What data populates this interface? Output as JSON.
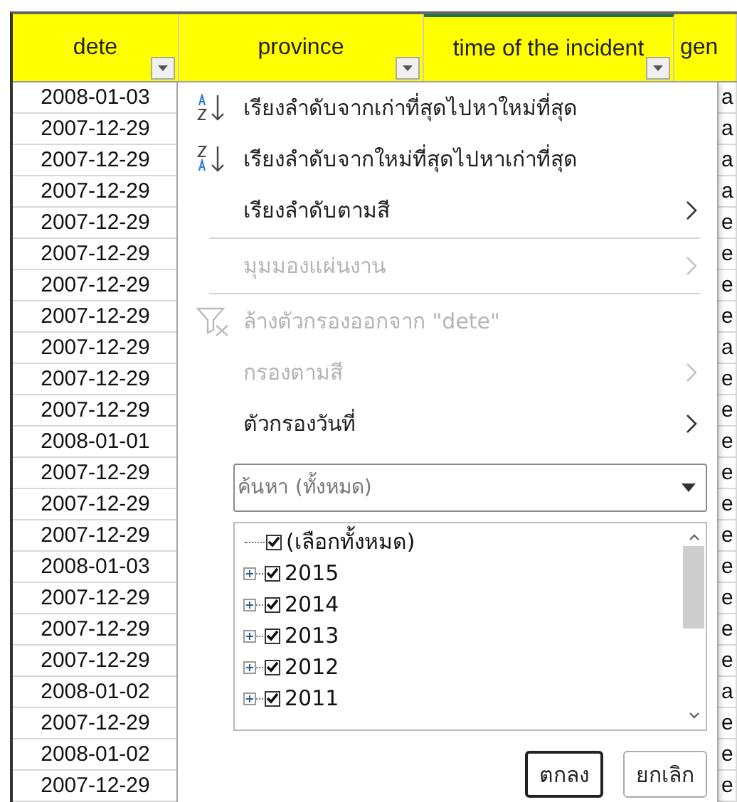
{
  "sheet": {
    "headers": [
      {
        "label": "dete",
        "filter_button": true,
        "selected": false
      },
      {
        "label": "province",
        "filter_button": true,
        "selected": false
      },
      {
        "label": "time of the incident",
        "filter_button": true,
        "selected": true
      },
      {
        "label": "gen",
        "filter_button": false,
        "selected": false
      }
    ],
    "rows": [
      {
        "dete": "2008-01-03",
        "column_4": "a"
      },
      {
        "dete": "2007-12-29",
        "column_4": "a"
      },
      {
        "dete": "2007-12-29",
        "column_4": "a"
      },
      {
        "dete": "2007-12-29",
        "column_4": "a"
      },
      {
        "dete": "2007-12-29",
        "column_4": "e"
      },
      {
        "dete": "2007-12-29",
        "column_4": "e"
      },
      {
        "dete": "2007-12-29",
        "column_4": "e"
      },
      {
        "dete": "2007-12-29",
        "column_4": "e"
      },
      {
        "dete": "2007-12-29",
        "column_4": "a"
      },
      {
        "dete": "2007-12-29",
        "column_4": "e"
      },
      {
        "dete": "2007-12-29",
        "column_4": "e"
      },
      {
        "dete": "2008-01-01",
        "column_4": "e"
      },
      {
        "dete": "2007-12-29",
        "column_4": "e"
      },
      {
        "dete": "2007-12-29",
        "column_4": "e"
      },
      {
        "dete": "2007-12-29",
        "column_4": "e"
      },
      {
        "dete": "2008-01-03",
        "column_4": "e"
      },
      {
        "dete": "2007-12-29",
        "column_4": "e"
      },
      {
        "dete": "2007-12-29",
        "column_4": "e"
      },
      {
        "dete": "2007-12-29",
        "column_4": "e"
      },
      {
        "dete": "2008-01-02",
        "column_4": "a"
      },
      {
        "dete": "2007-12-29",
        "column_4": "e"
      },
      {
        "dete": "2008-01-02",
        "column_4": "e"
      },
      {
        "dete": "2007-12-29",
        "column_4": "e"
      }
    ]
  },
  "filter_menu": {
    "items": [
      {
        "kind": "sort_ascending",
        "label": "เรียงลำดับจากเก่าที่สุดไปหาใหม่ที่สุด",
        "disabled": false,
        "submenu": false
      },
      {
        "kind": "sort_descending",
        "label": "เรียงลำดับจากใหม่ที่สุดไปหาเก่าที่สุด",
        "disabled": false,
        "submenu": false
      },
      {
        "kind": "plain",
        "label": "เรียงลำดับตามสี",
        "disabled": false,
        "submenu": true
      },
      {
        "kind": "separator"
      },
      {
        "kind": "plain",
        "label": "มุมมองแผ่นงาน",
        "disabled": true,
        "submenu": true
      },
      {
        "kind": "separator"
      },
      {
        "kind": "clear_filter",
        "label": "ล้างตัวกรองออกจาก \"dete\"",
        "disabled": true,
        "submenu": false
      },
      {
        "kind": "plain",
        "label": "กรองตามสี",
        "disabled": true,
        "submenu": true
      },
      {
        "kind": "plain",
        "label": "ตัวกรองวันที่",
        "disabled": false,
        "submenu": true
      }
    ],
    "search": {
      "placeholder": "ค้นหา (ทั้งหมด)"
    },
    "values": [
      {
        "label": "(เลือกทั้งหมด)",
        "checked": true,
        "expandable": false
      },
      {
        "label": "2015",
        "checked": true,
        "expandable": true
      },
      {
        "label": "2014",
        "checked": true,
        "expandable": true
      },
      {
        "label": "2013",
        "checked": true,
        "expandable": true
      },
      {
        "label": "2012",
        "checked": true,
        "expandable": true
      },
      {
        "label": "2011",
        "checked": true,
        "expandable": true
      }
    ],
    "buttons": [
      {
        "label": "ตกลง",
        "default": true
      },
      {
        "label": "ยกเลิก",
        "default": false
      }
    ]
  }
}
